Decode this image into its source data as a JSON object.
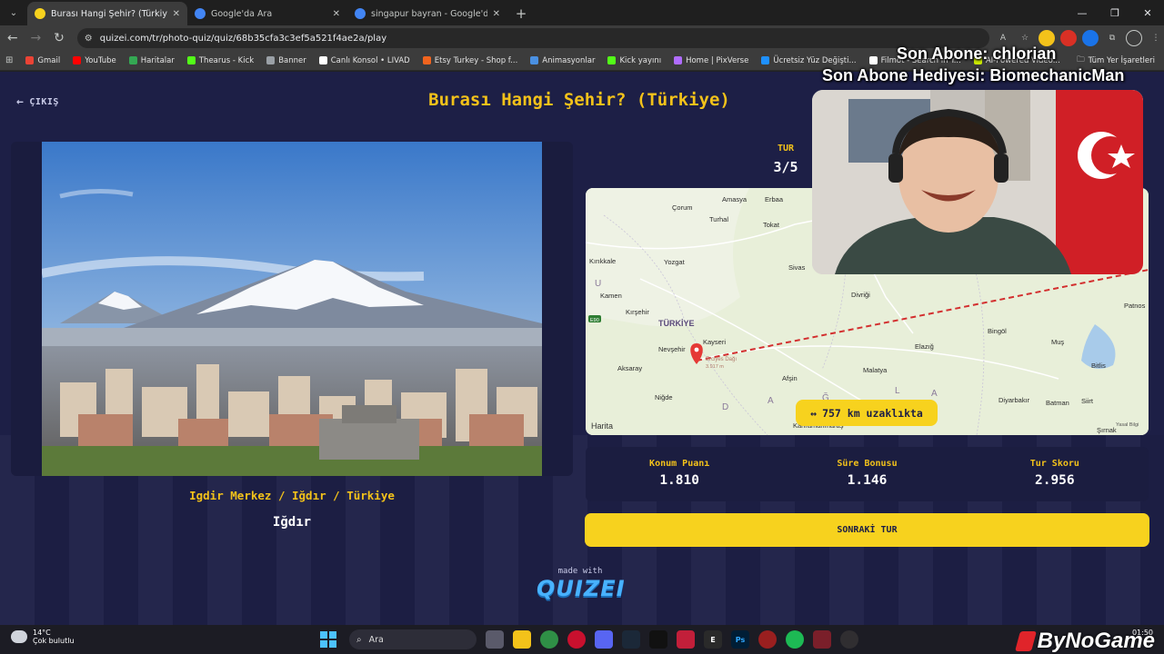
{
  "browser": {
    "tabs": [
      {
        "title": "Burası Hangi Şehir? (Türkiye) - Q",
        "active": true,
        "favicon_color": "#f7d21e"
      },
      {
        "title": "Google'da Ara",
        "active": false,
        "favicon_color": "#4285f4"
      },
      {
        "title": "singapur bayran - Google'da Ara",
        "active": false,
        "favicon_color": "#4285f4"
      }
    ],
    "url": "quizei.com/tr/photo-quiz/quiz/68b35cfa3c3ef5a521f4ae2a/play",
    "bookmarks": [
      {
        "label": "Gmail",
        "color": "#ea4335"
      },
      {
        "label": "YouTube",
        "color": "#ff0000"
      },
      {
        "label": "Haritalar",
        "color": "#34a853"
      },
      {
        "label": "Thearus - Kick",
        "color": "#53fc18"
      },
      {
        "label": "Banner",
        "color": "#9aa0a6"
      },
      {
        "label": "Canlı Konsol • LIVAD",
        "color": "#ffffff"
      },
      {
        "label": "Etsy Turkey - Shop f...",
        "color": "#f1641e"
      },
      {
        "label": "Animasyonlar",
        "color": "#4a90e2"
      },
      {
        "label": "Kick yayını",
        "color": "#53fc18"
      },
      {
        "label": "Home | PixVerse",
        "color": "#b06cff"
      },
      {
        "label": "Ücretsiz Yüz Değişti...",
        "color": "#1e90ff"
      },
      {
        "label": "Filmot - Search in Y...",
        "color": "#ffffff"
      },
      {
        "label": "AI-Powered Video...",
        "color": "#c8e600"
      }
    ],
    "bookmarks_right": "Tüm Yer İşaretleri"
  },
  "quiz": {
    "exit_label": "ÇIKIŞ",
    "title": "Burası Hangi Şehir? (Türkiye)",
    "answer_location": "Igdir Merkez / Iğdır / Türkiye",
    "answer_city": "Iğdır",
    "round_label": "TUR",
    "round_value": "3/5",
    "distance_label": "757 km uzaklıkta",
    "scores": [
      {
        "label": "Konum Puanı",
        "value": "1.810"
      },
      {
        "label": "Süre Bonusu",
        "value": "1.146"
      },
      {
        "label": "Tur Skoru",
        "value": "2.956"
      }
    ],
    "next_button": "SONRAKİ TUR",
    "made_with": "made with",
    "logo": "QUIZEI"
  },
  "map": {
    "country": "TÜRKİYE",
    "cities": [
      "Amasya",
      "Erbaa",
      "Çorum",
      "Turhal",
      "Tokat",
      "Yozgat",
      "Sivas",
      "Kırıkkale",
      "Kırşehir",
      "Kayseri",
      "Nevşehir",
      "Aksaray",
      "Niğde",
      "Afşin",
      "Malatya",
      "Elazığ",
      "Bingöl",
      "Muş",
      "Bitlis",
      "Patnos",
      "Diyarbakır",
      "Batman",
      "Siirt",
      "Şırnak",
      "Kahramanmaraş",
      "Kamen",
      "Divriği"
    ],
    "guess_label": "Erciyes Dağı",
    "guess_elevation": "3.917 m",
    "road_label": "E90",
    "attribution": "Harita",
    "legal": "Yasal Bilgi"
  },
  "overlay": {
    "last_sub": "Son Abone: chlorian",
    "last_gift": "Son Abone Hediyesi: BiomechanicMan"
  },
  "taskbar": {
    "temp": "14°C",
    "weather": "Çok bulutlu",
    "search": "Ara",
    "time": "01:50",
    "watermark": "ByNoGame"
  }
}
